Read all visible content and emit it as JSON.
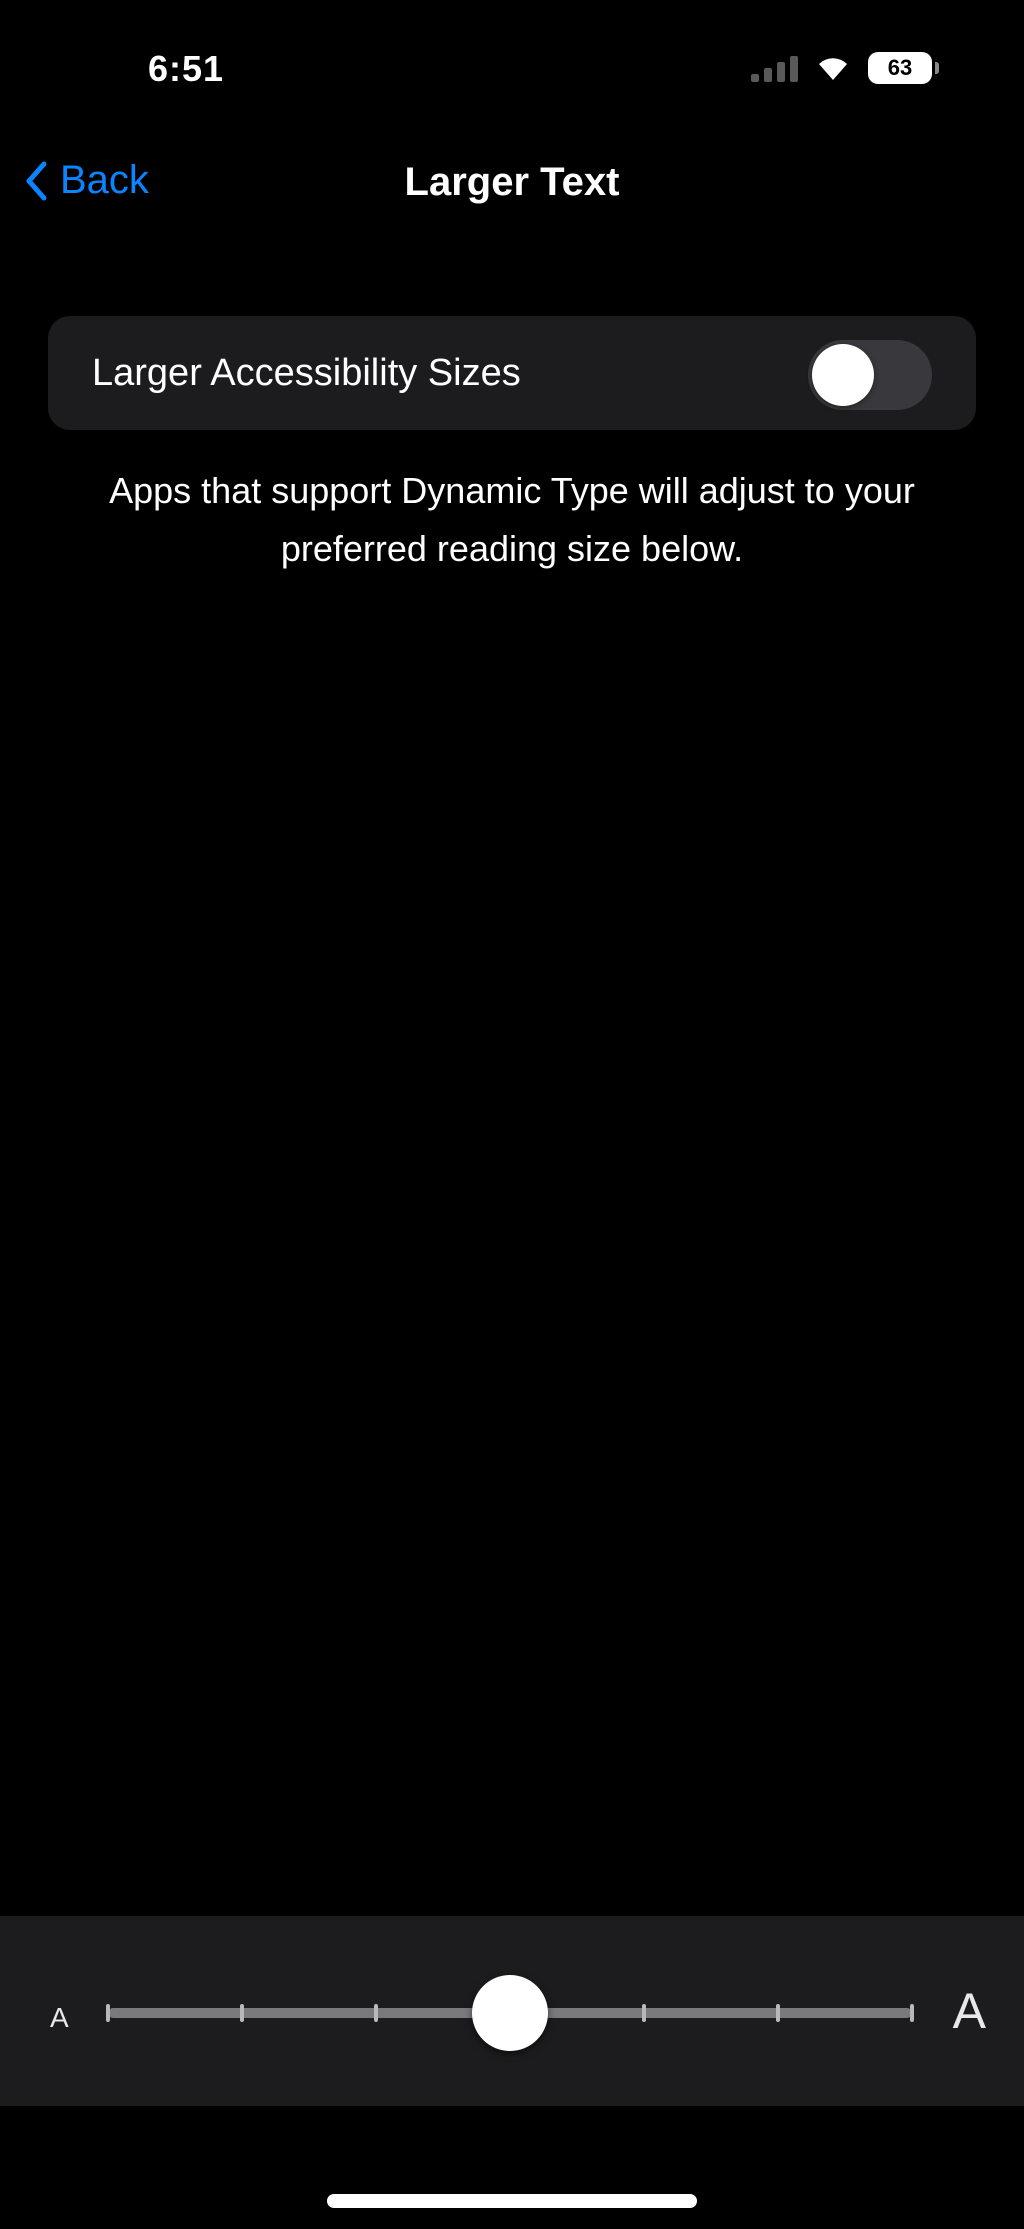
{
  "status_bar": {
    "time": "6:51",
    "battery_level": "63"
  },
  "nav": {
    "back_label": "Back",
    "title": "Larger Text"
  },
  "settings": {
    "larger_accessibility_sizes": {
      "label": "Larger Accessibility Sizes",
      "enabled": false
    },
    "footer": "Apps that support Dynamic Type will adjust to your preferred reading size below."
  },
  "text_size_slider": {
    "steps": 7,
    "selected_step": 3,
    "min_glyph": "A",
    "max_glyph": "A"
  },
  "colors": {
    "accent": "#0a84ff",
    "background": "#000000",
    "group_background": "#1c1c1e",
    "toggle_off": "#39393d"
  },
  "icons": {
    "back": "chevron-left-icon",
    "wifi": "wifi-icon",
    "signal": "cellular-signal-icon",
    "battery": "battery-icon"
  }
}
